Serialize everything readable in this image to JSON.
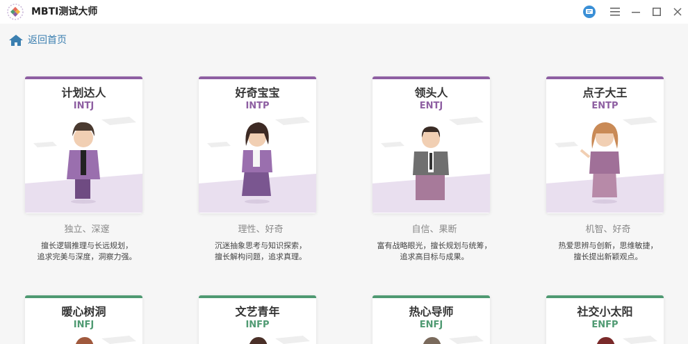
{
  "window": {
    "title": "MBTI测试大师",
    "controls": [
      "feedback-icon",
      "menu-icon",
      "minimize-icon",
      "maximize-icon",
      "close-icon"
    ]
  },
  "nav": {
    "back_label": "返回首页"
  },
  "colors": {
    "nt_accent": "#8e5fa2",
    "nf_accent": "#4f9a72",
    "link": "#3b7fb0"
  },
  "row1": [
    {
      "name": "计划达人",
      "code": "INTJ",
      "traits": "独立、深邃",
      "desc1": "擅长逻辑推理与长远规划，",
      "desc2": "追求完美与深度，洞察力强。"
    },
    {
      "name": "好奇宝宝",
      "code": "INTP",
      "traits": "理性、好奇",
      "desc1": "沉迷抽象思考与知识探索，",
      "desc2": "擅长解构问题，追求真理。"
    },
    {
      "name": "领头人",
      "code": "ENTJ",
      "traits": "自信、果断",
      "desc1": "富有战略眼光，擅长规划与统筹，",
      "desc2": "追求高目标与成果。"
    },
    {
      "name": "点子大王",
      "code": "ENTP",
      "traits": "机智、好奇",
      "desc1": "热爱思辨与创新，思维敏捷，",
      "desc2": "擅长提出新颖观点。"
    }
  ],
  "row2": [
    {
      "name": "暖心树洞",
      "code": "INFJ"
    },
    {
      "name": "文艺青年",
      "code": "INFP"
    },
    {
      "name": "热心导师",
      "code": "ENFJ"
    },
    {
      "name": "社交小太阳",
      "code": "ENFP"
    }
  ]
}
